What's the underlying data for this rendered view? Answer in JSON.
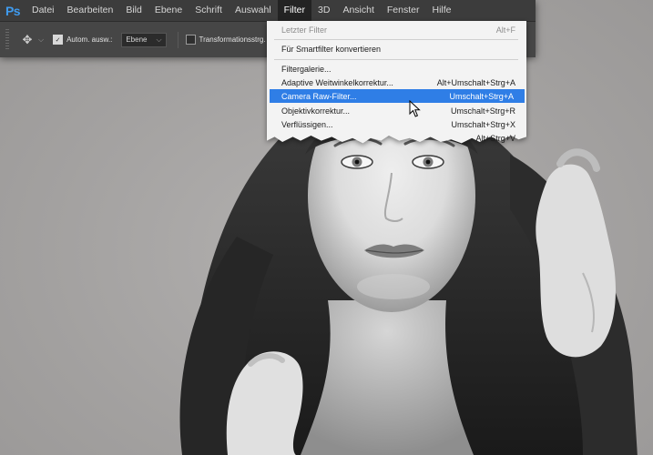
{
  "app": {
    "logo": "Ps"
  },
  "menubar": {
    "items": [
      "Datei",
      "Bearbeiten",
      "Bild",
      "Ebene",
      "Schrift",
      "Auswahl",
      "Filter",
      "3D",
      "Ansicht",
      "Fenster",
      "Hilfe"
    ],
    "active": "Filter"
  },
  "options": {
    "move_tool_icon": "move-icon",
    "auto_select_checked": true,
    "auto_select_label": "Autom. ausw.:",
    "layer_select_value": "Ebene",
    "transform_checked": false,
    "transform_label": "Transformationsstrg."
  },
  "filter_menu": {
    "items": [
      {
        "label": "Letzter Filter",
        "shortcut": "Alt+F",
        "disabled": true
      },
      {
        "separator": true
      },
      {
        "label": "Für Smartfilter konvertieren",
        "shortcut": ""
      },
      {
        "separator": true
      },
      {
        "label": "Filtergalerie...",
        "shortcut": ""
      },
      {
        "label": "Adaptive Weitwinkelkorrektur...",
        "shortcut": "Alt+Umschalt+Strg+A"
      },
      {
        "label": "Camera Raw-Filter...",
        "shortcut": "Umschalt+Strg+A",
        "highlighted": true
      },
      {
        "label": "Objektivkorrektur...",
        "shortcut": "Umschalt+Strg+R"
      },
      {
        "label": "Verflüssigen...",
        "shortcut": "Umschalt+Strg+X"
      },
      {
        "label": "",
        "shortcut": "Alt+Strg+V"
      }
    ]
  },
  "colors": {
    "menu_highlight": "#2f7ee6",
    "ps_blue": "#3f9bef",
    "canvas_bg": "#a3a1a0"
  }
}
